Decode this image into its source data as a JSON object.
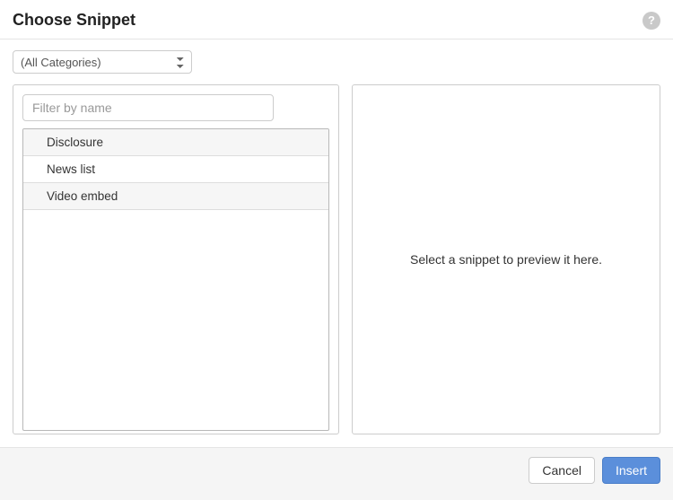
{
  "header": {
    "title": "Choose Snippet",
    "help_symbol": "?"
  },
  "category": {
    "selected": "(All Categories)"
  },
  "filter": {
    "placeholder": "Filter by name"
  },
  "snippets": [
    {
      "label": "Disclosure"
    },
    {
      "label": "News list"
    },
    {
      "label": "Video embed"
    }
  ],
  "preview": {
    "empty_text": "Select a snippet to preview it here."
  },
  "footer": {
    "cancel_label": "Cancel",
    "insert_label": "Insert"
  }
}
